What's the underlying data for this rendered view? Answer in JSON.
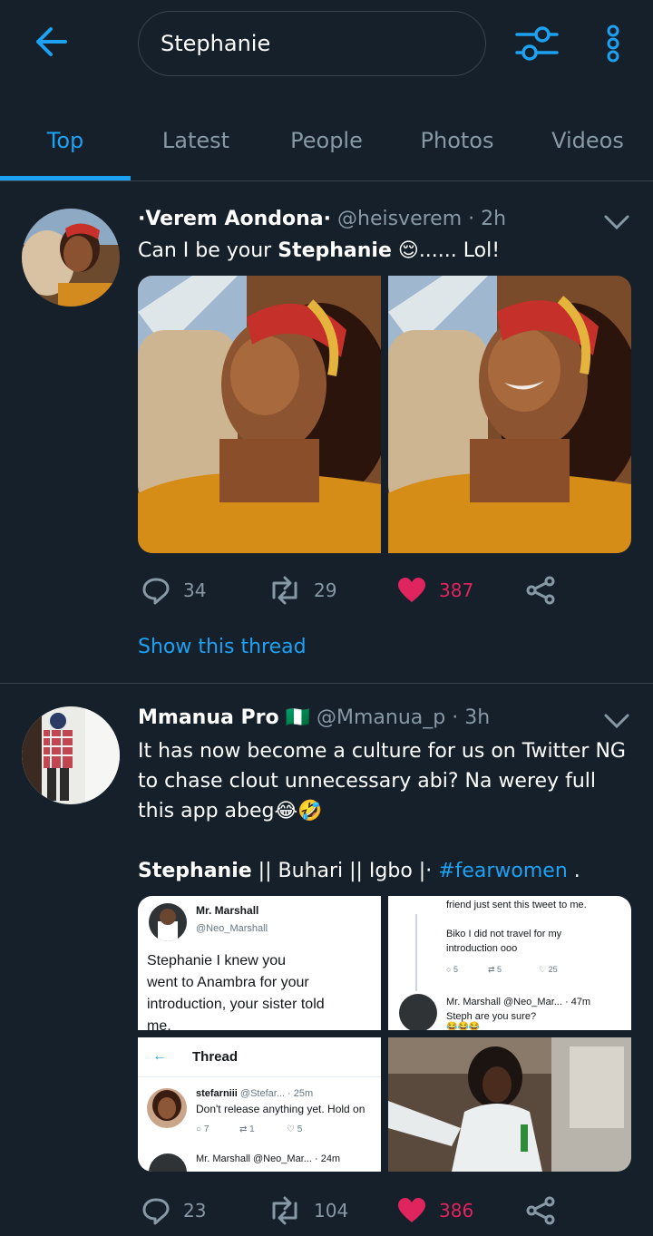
{
  "search": {
    "query": "Stephanie"
  },
  "tabs": [
    "Top",
    "Latest",
    "People",
    "Photos",
    "Videos"
  ],
  "active_tab": "Top",
  "colors": {
    "background": "#15202b",
    "accent": "#1da1f2",
    "like": "#e0245e",
    "muted": "#8899a6"
  },
  "tweets": [
    {
      "display_name": "·Verem Aondona·",
      "handle": "@heisverem",
      "time": "· 2h",
      "text_prefix": "Can I be your ",
      "text_highlight": "Stephanie",
      "text_suffix": " 😌...... Lol!",
      "replies": "34",
      "retweets": "29",
      "likes": "387",
      "show_thread": "Show this thread"
    },
    {
      "display_name": "Mmanua Pro",
      "flag": "🇳🇬",
      "handle": "@Mmanua_p",
      "time": "· 3h",
      "text": "It has now become a culture for us on Twitter NG to chase clout unnecessary abi? Na werey full this app abeg😂🤣",
      "tags_highlight": "Stephanie",
      "tags_rest": " || Buhari || Igbo |· ",
      "hashtag": "#fearwomen",
      "tags_end": " .",
      "replies": "23",
      "retweets": "104",
      "likes": "386"
    }
  ],
  "embedded": {
    "s1": {
      "name": "Mr. Marshall",
      "handle": "@Neo_Marshall",
      "line1": "Stephanie I knew you",
      "line2": "went to Anambra for your",
      "line3": "introduction, your sister told",
      "line4": "me."
    },
    "s2": {
      "line0": "friend just sent this tweet to me.",
      "line1": "Biko I did not travel for my",
      "line2": "introduction ooo",
      "c_reply": "5",
      "c_rt": "5",
      "c_like": "25",
      "reply_head": "Mr. Marshall @Neo_Mar... · 47m",
      "reply_text": "Steph are you sure?",
      "reply_emoji": "😂😂😂"
    },
    "s3": {
      "title": "Thread",
      "head": "stefarniii",
      "head_rest": "@Stefar... · 25m",
      "text": "Don't release anything yet. Hold on",
      "c1": "7",
      "c2": "1",
      "c3": "5",
      "reply_head": "Mr. Marshall @Neo_Mar... · 24m"
    }
  }
}
